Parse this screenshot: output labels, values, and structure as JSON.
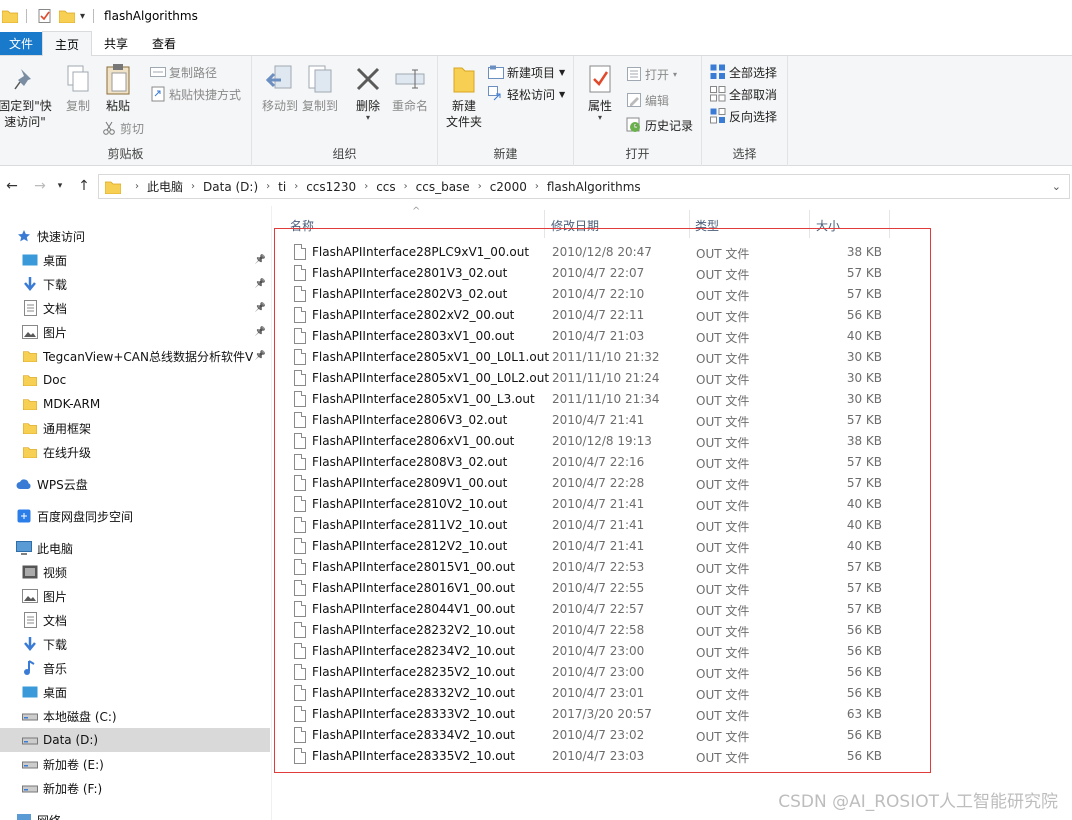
{
  "window": {
    "title": "flashAlgorithms"
  },
  "tabs": [
    {
      "label": "文件"
    },
    {
      "label": "主页"
    },
    {
      "label": "共享"
    },
    {
      "label": "查看"
    }
  ],
  "ribbon": {
    "clipboard": {
      "group_label": "剪贴板",
      "pin_label": "固定到\"快速访问\"",
      "copy_label": "复制",
      "paste_label": "粘贴",
      "copy_path_label": "复制路径",
      "paste_shortcut_label": "粘贴快捷方式",
      "cut_label": "剪切"
    },
    "organize": {
      "group_label": "组织",
      "move_to_label": "移动到",
      "copy_to_label": "复制到",
      "delete_label": "删除",
      "rename_label": "重命名"
    },
    "new": {
      "group_label": "新建",
      "new_folder_label": "新建\n文件夹",
      "new_item_label": "新建项目",
      "easy_access_label": "轻松访问"
    },
    "open": {
      "group_label": "打开",
      "properties_label": "属性",
      "open_label": "打开",
      "edit_label": "编辑",
      "history_label": "历史记录"
    },
    "select": {
      "group_label": "选择",
      "select_all_label": "全部选择",
      "select_none_label": "全部取消",
      "invert_label": "反向选择"
    }
  },
  "address": {
    "crumbs": [
      "此电脑",
      "Data (D:)",
      "ti",
      "ccs1230",
      "ccs",
      "ccs_base",
      "c2000",
      "flashAlgorithms"
    ]
  },
  "nav": {
    "quick_access": "快速访问",
    "items": [
      {
        "label": "桌面",
        "icon": "desktop-icon",
        "pinned": true
      },
      {
        "label": "下载",
        "icon": "download-icon",
        "pinned": true
      },
      {
        "label": "文档",
        "icon": "document-icon",
        "pinned": true
      },
      {
        "label": "图片",
        "icon": "picture-icon",
        "pinned": true
      },
      {
        "label": "TegcanView+CAN总线数据分析软件V",
        "icon": "folder-icon",
        "pinned": true
      },
      {
        "label": "Doc",
        "icon": "folder-icon",
        "pinned": false
      },
      {
        "label": "MDK-ARM",
        "icon": "folder-icon",
        "pinned": false
      },
      {
        "label": "通用框架",
        "icon": "folder-icon",
        "pinned": false
      },
      {
        "label": "在线升级",
        "icon": "folder-icon",
        "pinned": false
      }
    ],
    "wps": "WPS云盘",
    "baidu": "百度网盘同步空间",
    "this_pc": "此电脑",
    "pc_items": [
      {
        "label": "视频",
        "icon": "video-icon"
      },
      {
        "label": "图片",
        "icon": "picture-icon"
      },
      {
        "label": "文档",
        "icon": "document-icon"
      },
      {
        "label": "下载",
        "icon": "download-icon"
      },
      {
        "label": "音乐",
        "icon": "music-icon"
      },
      {
        "label": "桌面",
        "icon": "desktop-icon"
      },
      {
        "label": "本地磁盘 (C:)",
        "icon": "drive-icon"
      },
      {
        "label": "Data (D:)",
        "icon": "drive-icon"
      },
      {
        "label": "新加卷 (E:)",
        "icon": "drive-icon"
      },
      {
        "label": "新加卷 (F:)",
        "icon": "drive-icon"
      }
    ],
    "network": "网络"
  },
  "columns": {
    "name": "名称",
    "date": "修改日期",
    "type": "类型",
    "size": "大小"
  },
  "files": [
    {
      "name": "FlashAPIInterface28PLC9xV1_00.out",
      "date": "2010/12/8 20:47",
      "type": "OUT 文件",
      "size": "38 KB"
    },
    {
      "name": "FlashAPIInterface2801V3_02.out",
      "date": "2010/4/7 22:07",
      "type": "OUT 文件",
      "size": "57 KB"
    },
    {
      "name": "FlashAPIInterface2802V3_02.out",
      "date": "2010/4/7 22:10",
      "type": "OUT 文件",
      "size": "57 KB"
    },
    {
      "name": "FlashAPIInterface2802xV2_00.out",
      "date": "2010/4/7 22:11",
      "type": "OUT 文件",
      "size": "56 KB"
    },
    {
      "name": "FlashAPIInterface2803xV1_00.out",
      "date": "2010/4/7 21:03",
      "type": "OUT 文件",
      "size": "40 KB"
    },
    {
      "name": "FlashAPIInterface2805xV1_00_L0L1.out",
      "date": "2011/11/10 21:32",
      "type": "OUT 文件",
      "size": "30 KB"
    },
    {
      "name": "FlashAPIInterface2805xV1_00_L0L2.out",
      "date": "2011/11/10 21:24",
      "type": "OUT 文件",
      "size": "30 KB"
    },
    {
      "name": "FlashAPIInterface2805xV1_00_L3.out",
      "date": "2011/11/10 21:34",
      "type": "OUT 文件",
      "size": "30 KB"
    },
    {
      "name": "FlashAPIInterface2806V3_02.out",
      "date": "2010/4/7 21:41",
      "type": "OUT 文件",
      "size": "57 KB"
    },
    {
      "name": "FlashAPIInterface2806xV1_00.out",
      "date": "2010/12/8 19:13",
      "type": "OUT 文件",
      "size": "38 KB"
    },
    {
      "name": "FlashAPIInterface2808V3_02.out",
      "date": "2010/4/7 22:16",
      "type": "OUT 文件",
      "size": "57 KB"
    },
    {
      "name": "FlashAPIInterface2809V1_00.out",
      "date": "2010/4/7 22:28",
      "type": "OUT 文件",
      "size": "57 KB"
    },
    {
      "name": "FlashAPIInterface2810V2_10.out",
      "date": "2010/4/7 21:41",
      "type": "OUT 文件",
      "size": "40 KB"
    },
    {
      "name": "FlashAPIInterface2811V2_10.out",
      "date": "2010/4/7 21:41",
      "type": "OUT 文件",
      "size": "40 KB"
    },
    {
      "name": "FlashAPIInterface2812V2_10.out",
      "date": "2010/4/7 21:41",
      "type": "OUT 文件",
      "size": "40 KB"
    },
    {
      "name": "FlashAPIInterface28015V1_00.out",
      "date": "2010/4/7 22:53",
      "type": "OUT 文件",
      "size": "57 KB"
    },
    {
      "name": "FlashAPIInterface28016V1_00.out",
      "date": "2010/4/7 22:55",
      "type": "OUT 文件",
      "size": "57 KB"
    },
    {
      "name": "FlashAPIInterface28044V1_00.out",
      "date": "2010/4/7 22:57",
      "type": "OUT 文件",
      "size": "57 KB"
    },
    {
      "name": "FlashAPIInterface28232V2_10.out",
      "date": "2010/4/7 22:58",
      "type": "OUT 文件",
      "size": "56 KB"
    },
    {
      "name": "FlashAPIInterface28234V2_10.out",
      "date": "2010/4/7 23:00",
      "type": "OUT 文件",
      "size": "56 KB"
    },
    {
      "name": "FlashAPIInterface28235V2_10.out",
      "date": "2010/4/7 23:00",
      "type": "OUT 文件",
      "size": "56 KB"
    },
    {
      "name": "FlashAPIInterface28332V2_10.out",
      "date": "2010/4/7 23:01",
      "type": "OUT 文件",
      "size": "56 KB"
    },
    {
      "name": "FlashAPIInterface28333V2_10.out",
      "date": "2017/3/20 20:57",
      "type": "OUT 文件",
      "size": "63 KB"
    },
    {
      "name": "FlashAPIInterface28334V2_10.out",
      "date": "2010/4/7 23:02",
      "type": "OUT 文件",
      "size": "56 KB"
    },
    {
      "name": "FlashAPIInterface28335V2_10.out",
      "date": "2010/4/7 23:03",
      "type": "OUT 文件",
      "size": "56 KB"
    }
  ],
  "watermark": "CSDN @AI_ROSIOT人工智能研究院",
  "colors": {
    "file_tab": "#1979ca",
    "highlight_box": "#e23b3b",
    "ribbon_bg": "#f5f6f7"
  }
}
